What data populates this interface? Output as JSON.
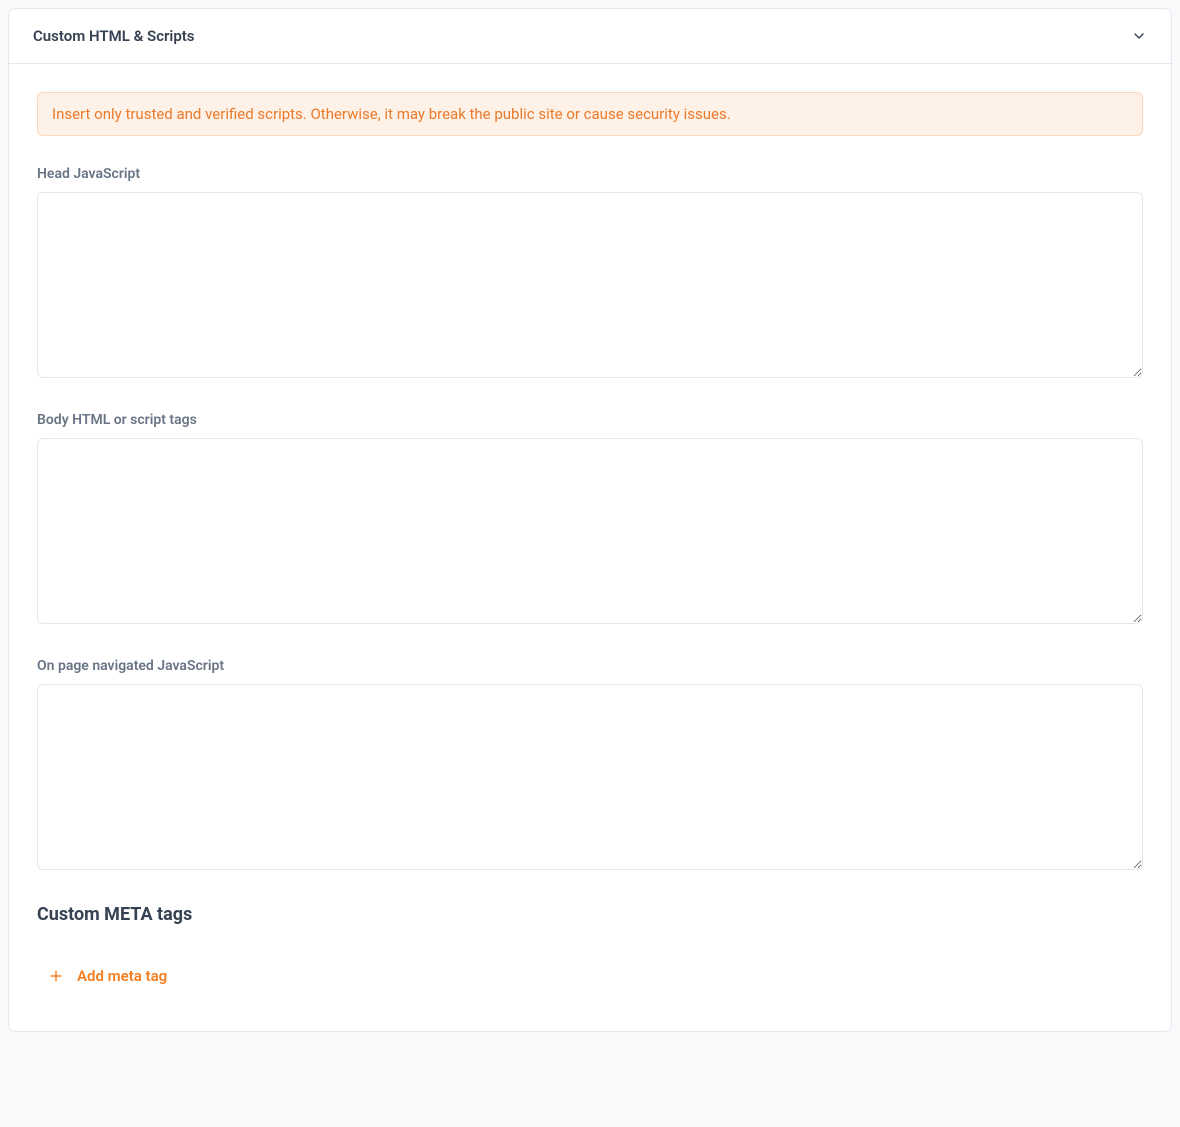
{
  "panel": {
    "title": "Custom HTML & Scripts",
    "alert": "Insert only trusted and verified scripts. Otherwise, it may break the public site or cause security issues.",
    "fields": {
      "head_js": {
        "label": "Head JavaScript",
        "value": ""
      },
      "body_html": {
        "label": "Body HTML or script tags",
        "value": ""
      },
      "on_navigate_js": {
        "label": "On page navigated JavaScript",
        "value": ""
      }
    },
    "meta_section": {
      "title": "Custom META tags",
      "add_button": "Add meta tag"
    }
  }
}
